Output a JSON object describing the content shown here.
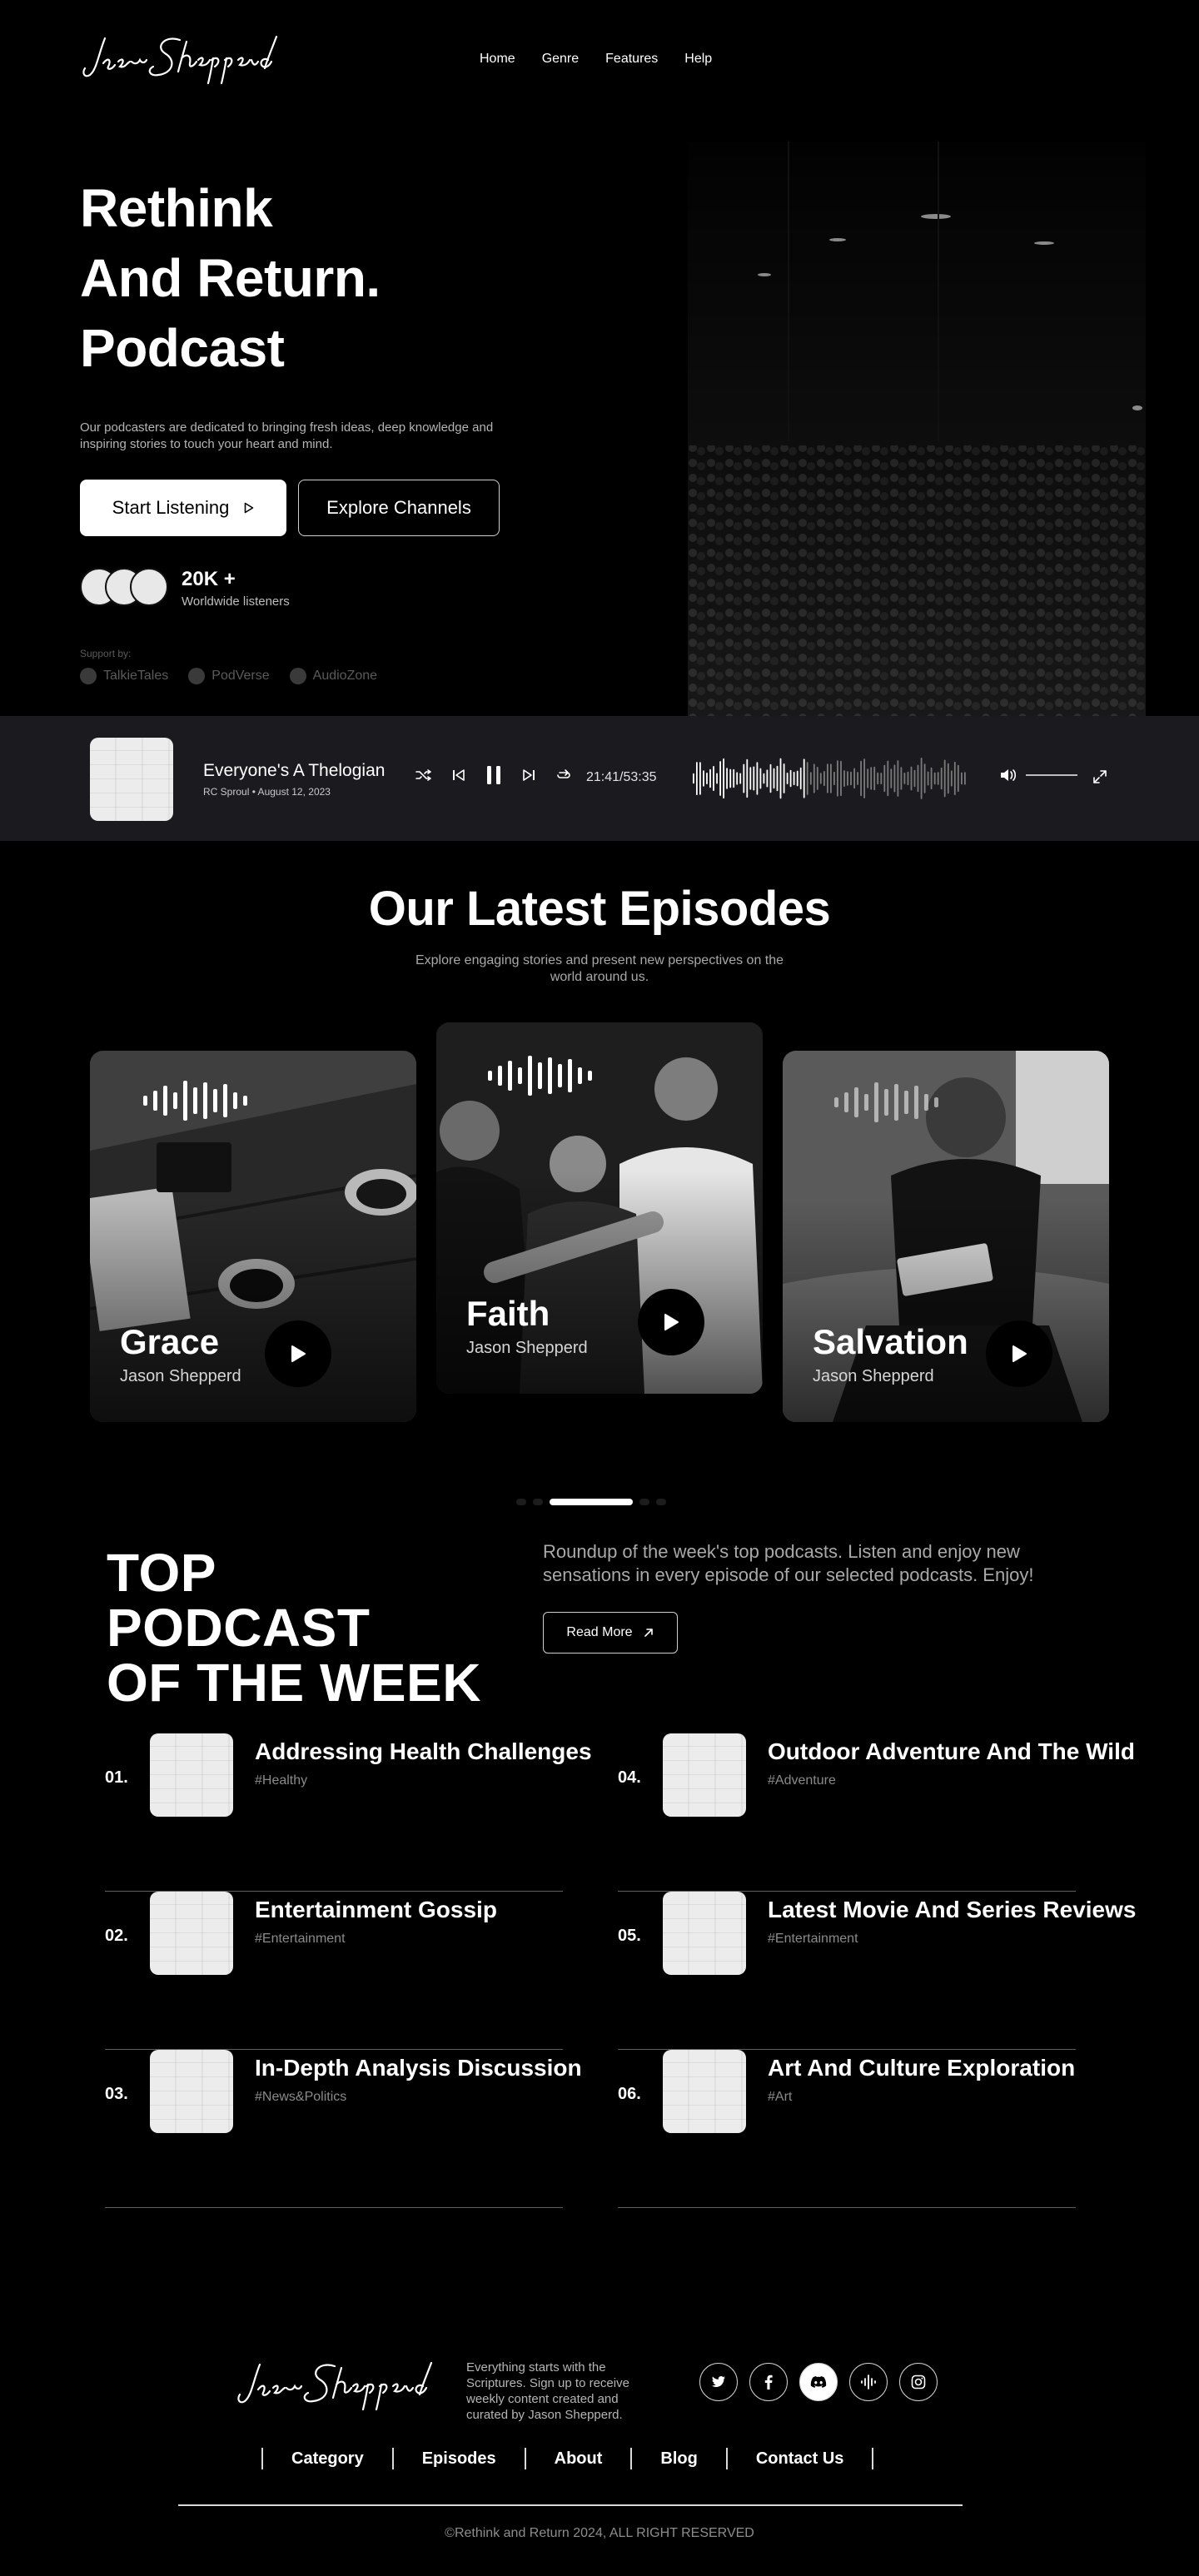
{
  "brand": {
    "logo_text": "Jason Shepperd"
  },
  "nav": {
    "items": [
      "Home",
      "Genre",
      "Features",
      "Help"
    ]
  },
  "hero": {
    "title_lines": [
      "Rethink",
      "And Return.",
      "Podcast"
    ],
    "description": "Our podcasters are dedicated to bringing fresh ideas, deep knowledge and inspiring stories to touch your heart and mind.",
    "primary_button": "Start Listening",
    "secondary_button": "Explore Channels",
    "stat_value": "20K +",
    "stat_label": "Worldwide listeners",
    "support_label": "Support by:",
    "partners": [
      "TalkieTales",
      "PodVerse",
      "AudioZone"
    ]
  },
  "player": {
    "title": "Everyone's A Thelogian",
    "subtitle": "RC Sproul • August 12, 2023",
    "time": "21:41/53:35",
    "progress": 0.405
  },
  "latest": {
    "title": "Our Latest Episodes",
    "subtitle": "Explore engaging stories and present new perspectives on the world around us.",
    "cards": [
      {
        "title": "Grace",
        "author": "Jason Shepperd"
      },
      {
        "title": "Faith",
        "author": "Jason Shepperd"
      },
      {
        "title": "Salvation",
        "author": "Jason Shepperd"
      }
    ]
  },
  "top": {
    "title_lines": [
      "TOP PODCAST",
      "OF THE WEEK"
    ],
    "description": "Roundup of the week's top podcasts. Listen and enjoy new sensations in every episode of our selected podcasts. Enjoy!",
    "read_more": "Read More",
    "items": [
      {
        "num": "01.",
        "title": "Addressing Health Challenges",
        "tag": "#Healthy"
      },
      {
        "num": "02.",
        "title": "Entertainment Gossip",
        "tag": "#Entertainment"
      },
      {
        "num": "03.",
        "title": "In-Depth Analysis Discussion",
        "tag": "#News&Politics"
      },
      {
        "num": "04.",
        "title": "Outdoor Adventure And The Wild",
        "tag": "#Adventure"
      },
      {
        "num": "05.",
        "title": "Latest Movie And Series Reviews",
        "tag": "#Entertainment"
      },
      {
        "num": "06.",
        "title": "Art And Culture Exploration",
        "tag": "#Art"
      }
    ]
  },
  "footer": {
    "text": "Everything starts with the Scriptures. Sign up to receive weekly content created and curated by Jason Shepperd.",
    "socials": [
      "twitter-icon",
      "facebook-icon",
      "discord-icon",
      "podcast-icon",
      "instagram-icon"
    ],
    "links": [
      "Category",
      "Episodes",
      "About",
      "Blog",
      "Contact Us"
    ],
    "copyright": "©Rethink and Return 2024, ALL RIGHT RESERVED"
  }
}
